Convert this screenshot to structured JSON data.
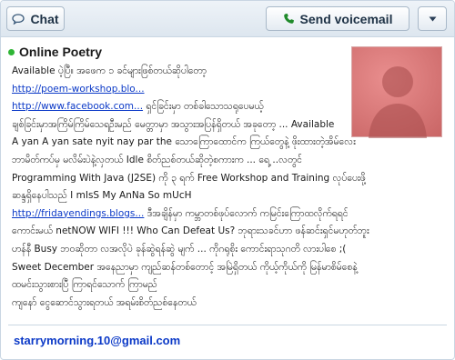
{
  "toolbar": {
    "chat_label": "Chat",
    "voicemail_label": "Send voicemail",
    "more_icon": "chevron-down-icon"
  },
  "contact": {
    "status": "online",
    "status_color": "#2fb535",
    "name": "Online Poetry",
    "email": "starrymorning.10@gmail.com"
  },
  "status_lines": [
    "Available ပဲ့ပြီ။ အဖေက ၁ ခင်များဖြစ်တယ်ဆိုပါတော့",
    "http://poem-workshop.blo...",
    "http://www.facebook.com... ရှင်ခြင်းမှာ တစ်ခါသောသရုပေမယ့်",
    "ချစ်ခြင်းမှာအကြိမ်ကြိမ်သေရဦးမည် မေတ္တာမှာ အသွားအပြန်ရှိတယ် အခုတော့ ... Available",
    "A yan A yan sate nyit nay par the သောကြောထောင်က ကြယ်တွေနဲ့ ဖိုးထားတဲ့အိမ်လေး",
    "ဘာမိတ်ကပ်မှ မလိမ်းပဲနဲ့လှတယ် Idle စိတ်ညစ်တယ်ဆိုတဲ့စကားက ... ရေ့ ..လတွင်",
    "Programming With Java (J2SE) ကို ၃ ရက် Free Workshop and Training လုပ်ပေးဖို့",
    "ဆန္ဒရှိနေပါသည် I mIsS My AnNa So mUcH",
    "http://fridayendings.blogs... ဒီအချိန်မှာ ကမ္ဘာတစ်ဖုပ်လောက် ကမြင်းကြောထလိုက်ရရင်",
    "ကောင်းမယ် netNOW WIFI !!! Who Can Defeat Us? ဘုရားသခင်ဟာ ဖန်ဆင်းရှင်မဟုတ်ဘူး",
    "ဟန်နီ Busy ဘဝဆိုတာ လအလိုပဲ ခုန်ဆွဲရန်ဆွဲ မျက် ... ကိုဂရုစိုး ကောင်းရာသုဂတိ လားပါစေ ;(",
    "Sweet December အနေညာမှာ ကျည်ဆန်တစ်တောင့် အမြဲရှိတယ် ကိုယ့်ကိုယ်ကို မြန်မာစိမ်စေနဲ့",
    "ထမင်းသွားစားပြီ ကြာရင်သောက် ကြာမည်",
    "ကျနော် ငွေဆောင်သွားရတယ် အရမ်းစိတ်ညစ်နေတယ်"
  ],
  "link_texts": {
    "poem": "http://poem-workshop.blo...",
    "facebook": "http://www.facebook.com...",
    "friday": "http://fridayendings.blogs..."
  }
}
